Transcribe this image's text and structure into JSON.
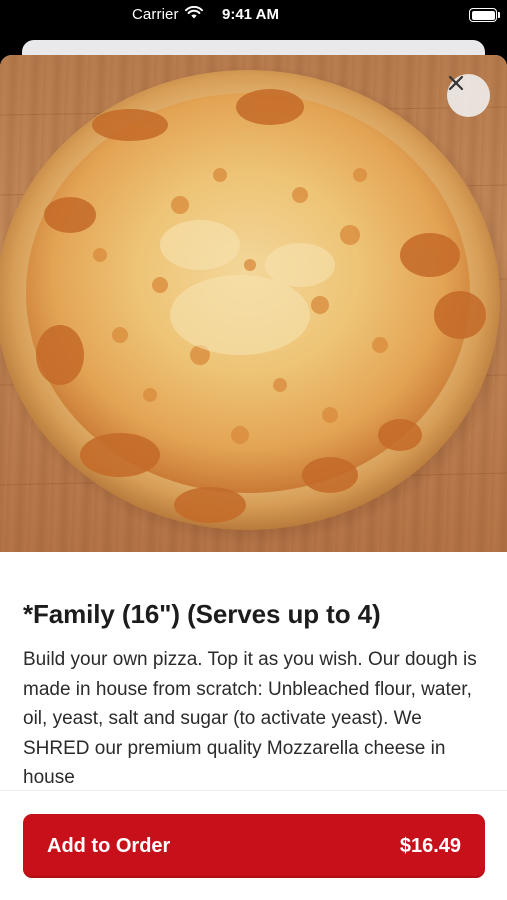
{
  "status_bar": {
    "carrier": "Carrier",
    "time": "9:41 AM",
    "icons": [
      "wifi-icon",
      "battery-icon"
    ]
  },
  "item": {
    "image": "pizza-photo",
    "title": "*Family (16\") (Serves up to 4)",
    "description": "Build your own pizza. Top it as you wish. Our dough is made in house from scratch: Unbleached flour, water, oil, yeast, salt and sugar (to activate yeast). We SHRED our premium quality Mozzarella cheese in house"
  },
  "close_button": {
    "icon": "close-icon"
  },
  "add_to_order": {
    "label": "Add to Order",
    "price": "$16.49"
  },
  "colors": {
    "accent": "#c8101a",
    "sheet_background": "#ffffff",
    "status_bar_background": "#000000"
  }
}
